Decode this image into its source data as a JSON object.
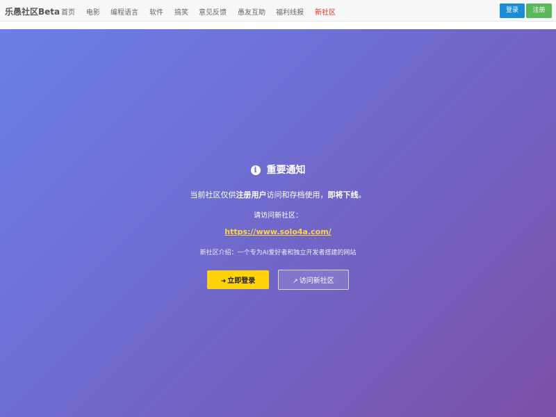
{
  "navbar": {
    "brand": "乐愚社区Beta",
    "items": [
      {
        "label": "首页"
      },
      {
        "label": "电影"
      },
      {
        "label": "编程语言"
      },
      {
        "label": "软件"
      },
      {
        "label": "搞笑"
      },
      {
        "label": "意见反馈"
      },
      {
        "label": "愚友互助"
      },
      {
        "label": "福利线报"
      },
      {
        "label": "新社区"
      }
    ],
    "login_label": "登录",
    "register_label": "注册"
  },
  "notice": {
    "icon": "info-circle-icon",
    "title": "重要通知",
    "line_prefix": "当前社区仅供",
    "line_bold1": "注册用户",
    "line_middle": "访问和存档使用，",
    "line_bold2": "即将下线",
    "line_suffix": "。",
    "visit_label": "请访问新社区：",
    "link": "https://www.solo4a.com/",
    "intro": "新社区介绍：一个专为AI爱好者和独立开发者搭建的网站",
    "login_now_label": "立即登录",
    "visit_new_label": "访问新社区"
  },
  "colors": {
    "accent_yellow": "#ffd20a",
    "link_yellow": "#ffd43b",
    "login_blue": "#1a8fd6",
    "register_green": "#5cb85c",
    "active_nav_red": "#e02b27",
    "gradient_start": "#6a80e6",
    "gradient_end": "#7b4fa6"
  }
}
